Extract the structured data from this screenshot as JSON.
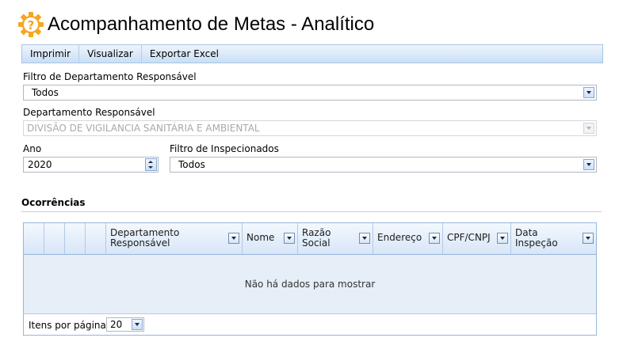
{
  "page": {
    "title": "Acompanhamento de Metas - Analítico",
    "title_icon": "gear-question-icon",
    "accent_color": "#f5a623"
  },
  "toolbar": {
    "items": [
      "Imprimir",
      "Visualizar",
      "Exportar Excel"
    ]
  },
  "form": {
    "dept_filter": {
      "label": "Filtro de Departamento Responsável",
      "value": "Todos"
    },
    "dept": {
      "label": "Departamento Responsável",
      "value": "DIVISÃO DE VIGILANCIA SANITÁRIA E AMBIENTAL"
    },
    "year": {
      "label": "Ano",
      "value": "2020"
    },
    "inspected_filter": {
      "label": "Filtro de Inspecionados",
      "value": "Todos"
    }
  },
  "section": {
    "title": "Ocorrências"
  },
  "grid": {
    "columns": [
      {
        "line1": "Departamento",
        "line2": "Responsável"
      },
      {
        "line1": "Nome",
        "line2": ""
      },
      {
        "line1": "Razão",
        "line2": "Social"
      },
      {
        "line1": "Endereço",
        "line2": ""
      },
      {
        "line1": "CPF/CNPJ",
        "line2": ""
      },
      {
        "line1": "Data",
        "line2": "Inspeção"
      }
    ],
    "empty_text": "Não há dados para mostrar",
    "page_size_label": "Itens por página:",
    "page_size": "20"
  }
}
